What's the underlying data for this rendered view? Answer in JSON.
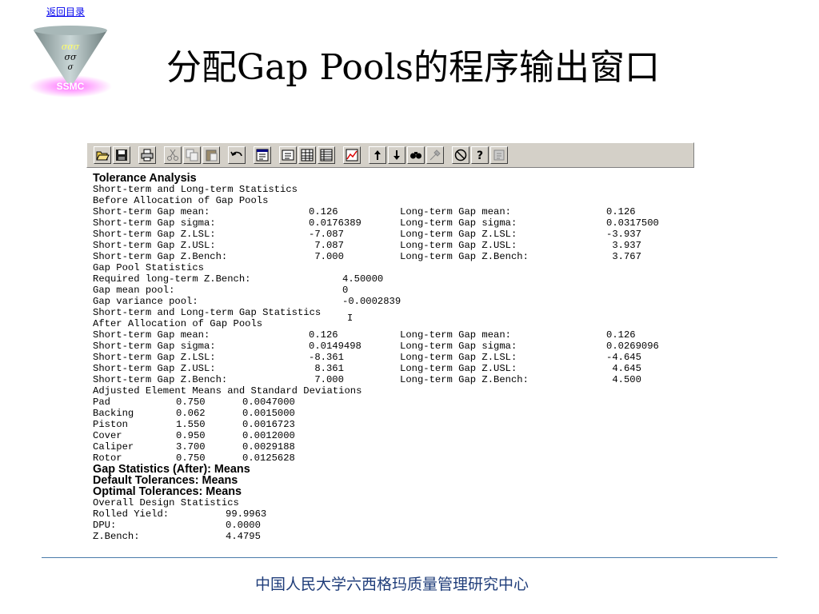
{
  "header": {
    "back_link": "返回目录",
    "logo_text": "SSMC",
    "title": "分配Gap Pools的程序输出窗口"
  },
  "toolbar": {
    "buttons": [
      "open-folder",
      "save",
      "print",
      "cut",
      "copy",
      "paste",
      "undo",
      "list-view",
      "report",
      "table",
      "grid",
      "chart",
      "up-arrow",
      "down-arrow",
      "find",
      "tools",
      "stop",
      "help",
      "info"
    ]
  },
  "output": {
    "heading": "Tolerance Analysis",
    "before": {
      "title1": "Short-term and Long-term Statistics",
      "title2": "Before Allocation of Gap Pools",
      "rows": [
        [
          "Short-term Gap mean:",
          "0.126",
          "Long-term Gap mean:",
          "0.126"
        ],
        [
          "Short-term Gap sigma:",
          "0.0176389",
          "Long-term Gap sigma:",
          "0.0317500"
        ],
        [
          "Short-term Gap Z.LSL:",
          "-7.087",
          "Long-term Gap Z.LSL:",
          "-3.937"
        ],
        [
          "Short-term Gap Z.USL:",
          " 7.087",
          "Long-term Gap Z.USL:",
          " 3.937"
        ],
        [
          "Short-term Gap Z.Bench:",
          " 7.000",
          "Long-term Gap Z.Bench:",
          " 3.767"
        ]
      ]
    },
    "pool": {
      "title": "Gap Pool Statistics",
      "rows": [
        [
          "Required long-term Z.Bench:",
          "4.50000"
        ],
        [
          "Gap mean pool:",
          "0"
        ],
        [
          "Gap variance pool:",
          "-0.0002839"
        ]
      ]
    },
    "after": {
      "title1": "Short-term and Long-term Gap Statistics",
      "title2": "After Allocation of Gap Pools",
      "rows": [
        [
          "Short-term Gap mean:",
          "0.126",
          "Long-term Gap mean:",
          "0.126"
        ],
        [
          "Short-term Gap sigma:",
          "0.0149498",
          "Long-term Gap sigma:",
          "0.0269096"
        ],
        [
          "Short-term Gap Z.LSL:",
          "-8.361",
          "Long-term Gap Z.LSL:",
          "-4.645"
        ],
        [
          "Short-term Gap Z.USL:",
          " 8.361",
          "Long-term Gap Z.USL:",
          " 4.645"
        ],
        [
          "Short-term Gap Z.Bench:",
          " 7.000",
          "Long-term Gap Z.Bench:",
          " 4.500"
        ]
      ]
    },
    "elements": {
      "title": "Adjusted Element Means and Standard Deviations",
      "rows": [
        [
          "Pad",
          "0.750",
          "0.0047000"
        ],
        [
          "Backing",
          "0.062",
          "0.0015000"
        ],
        [
          "Piston",
          "1.550",
          "0.0016723"
        ],
        [
          "Cover",
          "0.950",
          "0.0012000"
        ],
        [
          "Caliper",
          "3.700",
          "0.0029188"
        ],
        [
          "Rotor",
          "0.750",
          "0.0125628"
        ]
      ]
    },
    "bold_lines": [
      "Gap Statistics (After): Means",
      "Default Tolerances: Means",
      "Optimal Tolerances: Means"
    ],
    "overall": {
      "title": "Overall Design Statistics",
      "rows": [
        [
          "Rolled Yield:",
          "99.9963"
        ],
        [
          "DPU:",
          "0.0000"
        ],
        [
          "Z.Bench:",
          "4.4795"
        ]
      ]
    }
  },
  "footer": {
    "text": "中国人民大学六西格玛质量管理研究中心"
  },
  "colors": {
    "toolbar_bg": "#d4d0c8",
    "divider": "#4a7cab",
    "footer_text": "#1f3d7a",
    "link": "#0000ee",
    "logo_accent": "#cc33ff"
  }
}
